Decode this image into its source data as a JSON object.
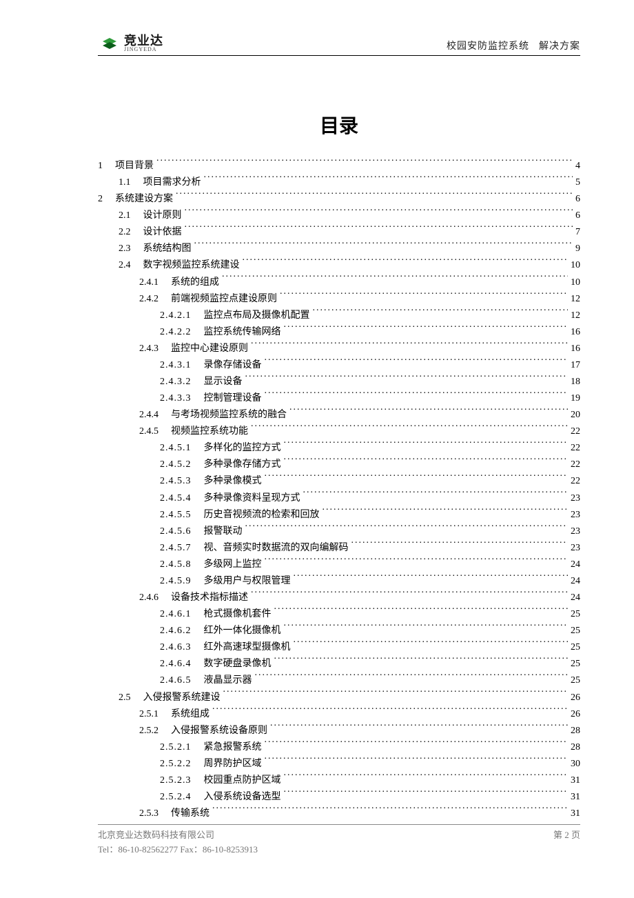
{
  "header": {
    "logo_cn": "竞业达",
    "logo_en": "JINGYEDA",
    "right_a": "校园安防监控系统",
    "right_b": "解决方案"
  },
  "title": "目录",
  "toc": [
    {
      "level": 1,
      "num": "1",
      "text": "项目背景",
      "page": "4"
    },
    {
      "level": 2,
      "num": "1.1",
      "text": "项目需求分析",
      "page": "5"
    },
    {
      "level": 1,
      "num": "2",
      "text": "系统建设方案",
      "page": "6"
    },
    {
      "level": 2,
      "num": "2.1",
      "text": "设计原则",
      "page": "6"
    },
    {
      "level": 2,
      "num": "2.2",
      "text": "设计依据",
      "page": "7"
    },
    {
      "level": 2,
      "num": "2.3",
      "text": "系统结构图",
      "page": "9"
    },
    {
      "level": 2,
      "num": "2.4",
      "text": "数字视频监控系统建设",
      "page": "10"
    },
    {
      "level": 3,
      "num": "2.4.1",
      "text": "系统的组成",
      "page": "10"
    },
    {
      "level": 3,
      "num": "2.4.2",
      "text": "前端视频监控点建设原则",
      "page": "12"
    },
    {
      "level": 4,
      "num": "2.4.2.1",
      "text": "监控点布局及摄像机配置",
      "page": "12"
    },
    {
      "level": 4,
      "num": "2.4.2.2",
      "text": "监控系统传输网络",
      "page": "16"
    },
    {
      "level": 3,
      "num": "2.4.3",
      "text": "监控中心建设原则",
      "page": "16"
    },
    {
      "level": 4,
      "num": "2.4.3.1",
      "text": "录像存储设备",
      "page": "17"
    },
    {
      "level": 4,
      "num": "2.4.3.2",
      "text": "显示设备",
      "page": "18"
    },
    {
      "level": 4,
      "num": "2.4.3.3",
      "text": "控制管理设备",
      "page": "19"
    },
    {
      "level": 3,
      "num": "2.4.4",
      "text": "与考场视频监控系统的融合",
      "page": "20"
    },
    {
      "level": 3,
      "num": "2.4.5",
      "text": "视频监控系统功能",
      "page": "22"
    },
    {
      "level": 4,
      "num": "2.4.5.1",
      "text": "多样化的监控方式",
      "page": "22"
    },
    {
      "level": 4,
      "num": "2.4.5.2",
      "text": "多种录像存储方式",
      "page": "22"
    },
    {
      "level": 4,
      "num": "2.4.5.3",
      "text": "多种录像模式",
      "page": "22"
    },
    {
      "level": 4,
      "num": "2.4.5.4",
      "text": "多种录像资料呈现方式",
      "page": "23"
    },
    {
      "level": 4,
      "num": "2.4.5.5",
      "text": "历史音视频流的检索和回放",
      "page": "23"
    },
    {
      "level": 4,
      "num": "2.4.5.6",
      "text": "报警联动",
      "page": "23"
    },
    {
      "level": 4,
      "num": "2.4.5.7",
      "text": "视、音频实时数据流的双向编解码",
      "page": "23"
    },
    {
      "level": 4,
      "num": "2.4.5.8",
      "text": "多级网上监控",
      "page": "24"
    },
    {
      "level": 4,
      "num": "2.4.5.9",
      "text": "多级用户与权限管理",
      "page": "24"
    },
    {
      "level": 3,
      "num": "2.4.6",
      "text": "设备技术指标描述",
      "page": "24"
    },
    {
      "level": 4,
      "num": "2.4.6.1",
      "text": "枪式摄像机套件",
      "page": "25"
    },
    {
      "level": 4,
      "num": "2.4.6.2",
      "text": "红外一体化摄像机",
      "page": "25"
    },
    {
      "level": 4,
      "num": "2.4.6.3",
      "text": "红外高速球型摄像机",
      "page": "25"
    },
    {
      "level": 4,
      "num": "2.4.6.4",
      "text": "数字硬盘录像机",
      "page": "25"
    },
    {
      "level": 4,
      "num": "2.4.6.5",
      "text": "液晶显示器",
      "page": "25"
    },
    {
      "level": 2,
      "num": "2.5",
      "text": "入侵报警系统建设",
      "page": "26"
    },
    {
      "level": 3,
      "num": "2.5.1",
      "text": "系统组成",
      "page": "26"
    },
    {
      "level": 3,
      "num": "2.5.2",
      "text": "入侵报警系统设备原则",
      "page": "28"
    },
    {
      "level": 4,
      "num": "2.5.2.1",
      "text": "紧急报警系统",
      "page": "28"
    },
    {
      "level": 4,
      "num": "2.5.2.2",
      "text": "周界防护区域",
      "page": "30"
    },
    {
      "level": 4,
      "num": "2.5.2.3",
      "text": "校园重点防护区域",
      "page": "31"
    },
    {
      "level": 4,
      "num": "2.5.2.4",
      "text": "入侵系统设备选型",
      "page": "31"
    },
    {
      "level": 3,
      "num": "2.5.3",
      "text": "传输系统",
      "page": "31"
    }
  ],
  "footer": {
    "company": "北京竞业达数码科技有限公司",
    "page_label": "第 2 页",
    "contact": "Tel：86-10-82562277   Fax：86-10-8253913"
  }
}
